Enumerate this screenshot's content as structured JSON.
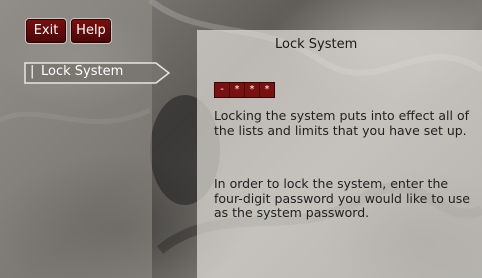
{
  "toolbar": {
    "exit_label": "Exit",
    "help_label": "Help"
  },
  "sidebar": {
    "items": [
      {
        "label": "Lock System",
        "selected": true
      }
    ]
  },
  "main": {
    "title": "Lock System",
    "password_mask": [
      "-",
      "*",
      "*",
      "*"
    ],
    "paragraphs": [
      "Locking the system puts into effect all of the lists and limits that you have set up.",
      "In order to lock the system, enter the four-digit password you would like to use as the system password."
    ]
  },
  "colors": {
    "button_bg": "#6a0b0b",
    "password_box_bg": "#7a1111",
    "content_panel_bg": "#e4e1db",
    "sidebar_bg": "#96928c"
  }
}
